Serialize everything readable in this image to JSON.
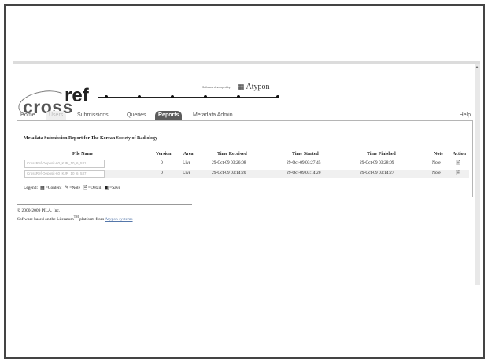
{
  "logo": {
    "cross": "cross",
    "ref": "ref"
  },
  "sponsor": {
    "developed_by": "Software developed by",
    "atypon": "Atypon"
  },
  "nav": {
    "tabs": [
      {
        "label": "Home",
        "state": "normal"
      },
      {
        "label": "Users",
        "state": "disabled"
      },
      {
        "label": "Submissions",
        "state": "normal"
      },
      {
        "label": "Queries",
        "state": "normal"
      },
      {
        "label": "Reports",
        "state": "active"
      },
      {
        "label": "Metadata Admin",
        "state": "normal"
      }
    ],
    "help": "Help"
  },
  "report": {
    "title": "Metadata Submission Report for The Korean Society of Radiology",
    "columns": [
      "File Name",
      "Version",
      "Area",
      "Time Received",
      "Time Started",
      "Time Finished",
      "Note",
      "Action"
    ],
    "rows": [
      {
        "file": "CrossRef-Deposit-60_KJR_10_6_531",
        "version": "0",
        "area": "Live",
        "received": "29-Oct-09 03:26:08",
        "started": "29-Oct-09 03:27:45",
        "finished": "29-Oct-09 03:28:09",
        "note": "Note",
        "action": "detail"
      },
      {
        "file": "CrossRef-Deposit-60_KJR_10_6_537",
        "version": "0",
        "area": "Live",
        "received": "29-Oct-09 03:14:20",
        "started": "29-Oct-09 03:14:20",
        "finished": "29-Oct-09 03:14:27",
        "note": "Note",
        "action": "detail"
      }
    ]
  },
  "legend": {
    "label": "Legend:",
    "items": [
      {
        "icon": "content-icon",
        "glyph": "▦",
        "text": "=Content"
      },
      {
        "icon": "note-icon",
        "glyph": "✎",
        "text": "=Note"
      },
      {
        "icon": "detail-icon",
        "glyph": "🗎",
        "text": "=Detail"
      },
      {
        "icon": "save-icon",
        "glyph": "▣",
        "text": "=Save"
      }
    ]
  },
  "footer": {
    "copyright": "© 2000-2009 PILA, Inc.",
    "software_prefix": "Software based on the Literatum",
    "tm": "TM",
    "software_mid": " platform from ",
    "link": "Atypon systems"
  }
}
